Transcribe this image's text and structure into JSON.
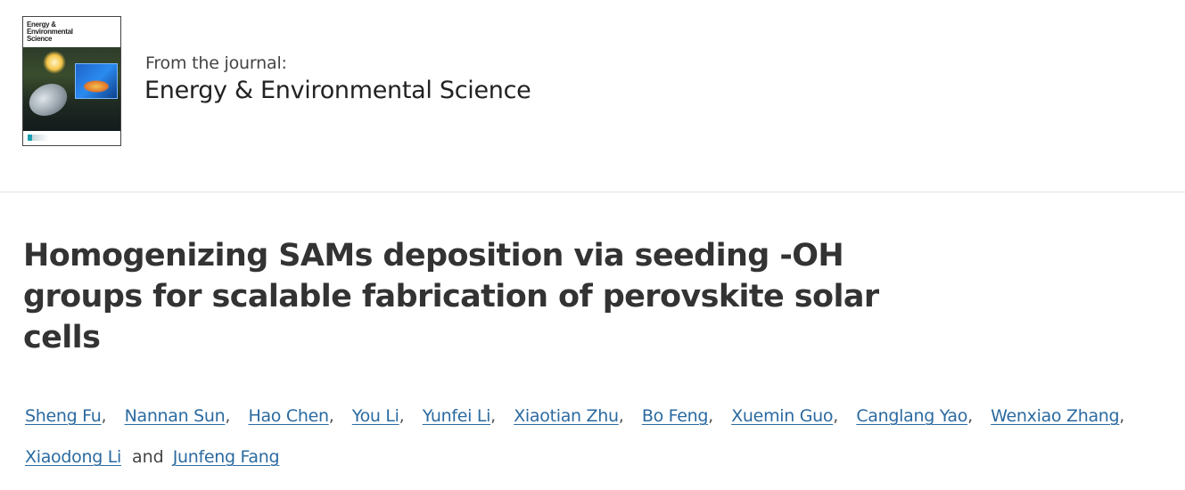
{
  "journal": {
    "from_label": "From the journal:",
    "name": "Energy & Environmental Science",
    "cover_title": "Energy & Environmental Science"
  },
  "article": {
    "title": "Homogenizing SAMs deposition via seeding -OH groups for scalable fabrication of perovskite solar cells"
  },
  "authors": {
    "list": [
      "Sheng Fu",
      "Nannan Sun",
      "Hao Chen",
      "You Li",
      "Yunfei Li",
      "Xiaotian Zhu",
      "Bo Feng",
      "Xuemin Guo",
      "Canglang Yao",
      "Wenxiao Zhang",
      "Xiaodong Li",
      "Junfeng Fang"
    ],
    "separator": ",",
    "and_label": "and"
  },
  "colors": {
    "link": "#2b6aa0",
    "title": "#333333",
    "divider": "#e3e3e3"
  }
}
